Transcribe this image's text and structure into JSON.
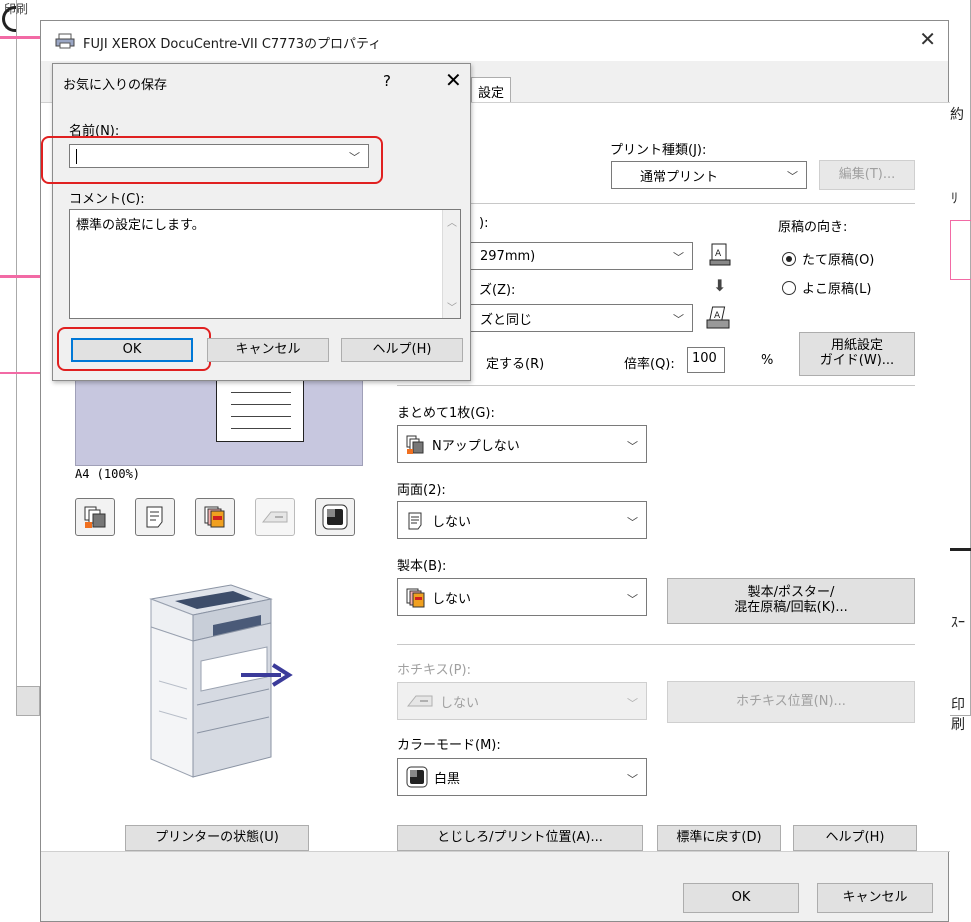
{
  "background": {
    "title": "印刷",
    "right_texts": [
      "約",
      "ﾘ",
      "ｽｰ",
      "印刷"
    ]
  },
  "window": {
    "title": "FUJI XEROX DocuCentre-VII C7773のプロパティ",
    "close_glyph": "✕",
    "tab_label": "設定"
  },
  "settings": {
    "print_type_label": "プリント種類(J):",
    "print_type_value": "通常プリント",
    "edit_button": "編集(T)...",
    "paper_size_label_partial": "):",
    "paper_size_value_partial": "297mm)",
    "output_size_label_partial": "ズ(Z):",
    "output_size_value_partial": "ズと同じ",
    "orientation_label": "原稿の向き:",
    "orientation_portrait": "たて原稿(O)",
    "orientation_landscape": "よこ原稿(L)",
    "scale_checkbox_partial": "定する(R)",
    "scale_label": "倍率(Q):",
    "scale_value": "100",
    "scale_unit": "%",
    "paper_guide_button": "用紙設定\nガイド(W)...",
    "nup_label": "まとめて1枚(G):",
    "nup_value": "Nアップしない",
    "duplex_label": "両面(2):",
    "duplex_value": "しない",
    "booklet_label": "製本(B):",
    "booklet_value": "しない",
    "booklet_button": "製本/ポスター/\n混在原稿/回転(K)...",
    "staple_label": "ホチキス(P):",
    "staple_value": "しない",
    "staple_position_button": "ホチキス位置(N)...",
    "color_mode_label": "カラーモード(M):",
    "color_mode_value": "白黒",
    "preview_caption": "A4 (100%)",
    "printer_status_button": "プリンターの状態(U)",
    "binding_button": "とじしろ/プリント位置(A)...",
    "reset_button": "標準に戻す(D)",
    "help_button": "ヘルプ(H)"
  },
  "footer": {
    "ok": "OK",
    "cancel": "キャンセル"
  },
  "favorites_dialog": {
    "title": "お気に入りの保存",
    "help_glyph": "?",
    "close_glyph": "✕",
    "name_label": "名前(N):",
    "name_value": "",
    "comment_label": "コメント(C):",
    "comment_value": "標準の設定にします。",
    "ok": "OK",
    "cancel": "キャンセル",
    "help": "ヘルプ(H)"
  },
  "colors": {
    "highlight": "#e02020",
    "pink_accent": "#f26aa5",
    "arrow": "#3b3b9a"
  }
}
